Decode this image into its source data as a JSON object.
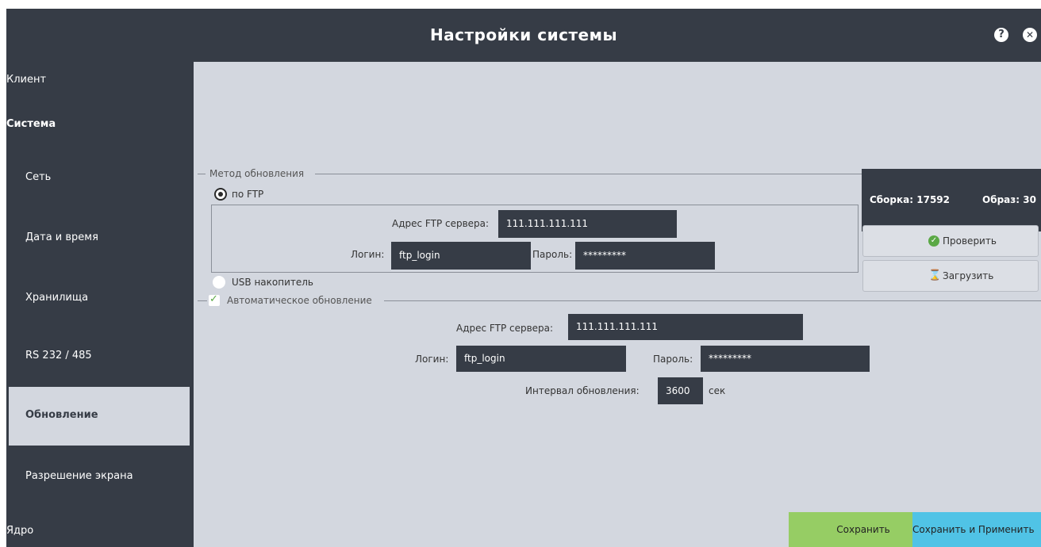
{
  "window": {
    "title": "Настройки системы",
    "help_icon": "help-icon",
    "close_icon": "close-icon"
  },
  "sidebar": {
    "items": [
      {
        "label": "Клиент"
      },
      {
        "label": "Система"
      },
      {
        "label": "Сеть"
      },
      {
        "label": "Дата и время"
      },
      {
        "label": "Хранилища"
      },
      {
        "label": "RS 232 / 485"
      },
      {
        "label": "Обновление"
      },
      {
        "label": "Разрешение экрана"
      },
      {
        "label": "Ядро"
      }
    ],
    "active": "Обновление"
  },
  "update_method": {
    "legend": "Метод обновления",
    "ftp_option": "по FTP",
    "ftp_selected": true,
    "ftp_address_label": "Адрес FTP сервера:",
    "ftp_address_value": "111.111.111.111",
    "login_label": "Логин:",
    "login_value": "ftp_login",
    "password_label": "Пароль:",
    "password_value": "*********",
    "usb_option": "USB накопитель"
  },
  "build_info": {
    "build": "Сборка: 17592",
    "image": "Образ: 30"
  },
  "actions": {
    "check_label": "Проверить",
    "load_label": "Загрузить"
  },
  "auto_update": {
    "legend": "Автоматическое обновление",
    "enabled": true,
    "ftp_address_label": "Адрес FTP сервера:",
    "ftp_address_value": "111.111.111.111",
    "login_label": "Логин:",
    "login_value": "ftp_login",
    "password_label": "Пароль:",
    "password_value": "*********",
    "interval_label": "Интервал обновления:",
    "interval_value": "3600",
    "interval_unit": "сек"
  },
  "footer": {
    "save_label": "Сохранить",
    "save_apply_label": "Сохранить и Применить",
    "save_color": "#96cd64",
    "save_apply_color": "#50c3e6"
  }
}
